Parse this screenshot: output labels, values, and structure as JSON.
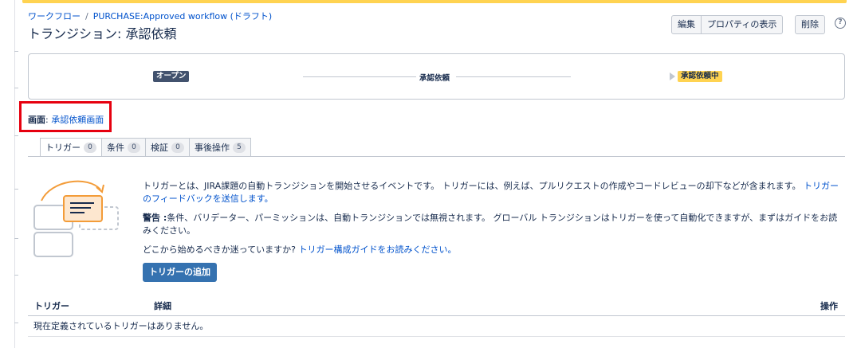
{
  "breadcrumb": {
    "workflows_link": "ワークフロー",
    "separator": "/",
    "workflow_link": "PURCHASE:Approved workflow (ドラフト)"
  },
  "title": "トランジション: 承認依頼",
  "actions": {
    "edit": "編集",
    "properties": "プロパティの表示",
    "delete": "削除",
    "help_icon": "question-circle-icon",
    "help_glyph": "?"
  },
  "diagram": {
    "from_status": "オープン",
    "transition": "承認依頼",
    "to_status": "承認依頼中"
  },
  "screen": {
    "label": "画面",
    "separator": ":",
    "link": "承認依頼画面"
  },
  "tabs": [
    {
      "label": "トリガー",
      "count": "0"
    },
    {
      "label": "条件",
      "count": "0"
    },
    {
      "label": "検証",
      "count": "0"
    },
    {
      "label": "事後操作",
      "count": "5"
    }
  ],
  "info": {
    "p1_text": "トリガーとは、JIRA課題の自動トランジションを開始させるイベントです。 トリガーには、例えば、プルリクエストの作成やコードレビューの却下などが含まれます。",
    "p1_link": "トリガーのフィードバックを送信します。",
    "p2_label": "警告 :",
    "p2_text": "条件、バリデーター、パーミッションは、自動トランジションでは無視されます。 グローバル トランジションはトリガーを使って自動化できますが、まずはガイドをお読みください。",
    "p3_text": "どこから始めるべきか迷っていますか?",
    "p3_link": "トリガー構成ガイドをお読みください。",
    "add_button": "トリガーの追加"
  },
  "table": {
    "headers": [
      "トリガー",
      "詳細",
      "操作"
    ],
    "empty_message": "現在定義されているトリガーはありません。"
  },
  "colors": {
    "from_status_bg": "#42526e",
    "to_status_bg": "#ffd351",
    "primary_button": "#3572b0",
    "link": "#0052cc",
    "highlight_border": "#e6000f",
    "illustration_orange": "#f39c39"
  }
}
